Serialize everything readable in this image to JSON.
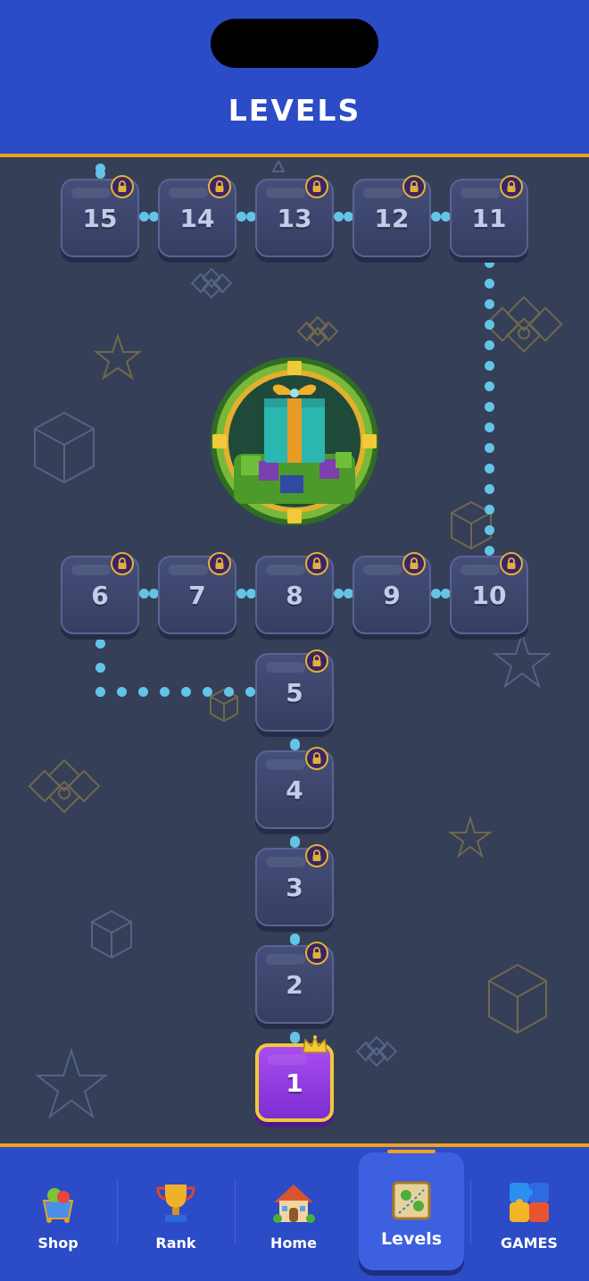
{
  "header": {
    "title": "LEVELS"
  },
  "levels": [
    {
      "number": "1",
      "state": "current"
    },
    {
      "number": "2",
      "state": "locked"
    },
    {
      "number": "3",
      "state": "locked"
    },
    {
      "number": "4",
      "state": "locked"
    },
    {
      "number": "5",
      "state": "locked"
    },
    {
      "number": "6",
      "state": "locked"
    },
    {
      "number": "7",
      "state": "locked"
    },
    {
      "number": "8",
      "state": "locked"
    },
    {
      "number": "9",
      "state": "locked"
    },
    {
      "number": "10",
      "state": "locked"
    },
    {
      "number": "11",
      "state": "locked"
    },
    {
      "number": "12",
      "state": "locked"
    },
    {
      "number": "13",
      "state": "locked"
    },
    {
      "number": "14",
      "state": "locked"
    },
    {
      "number": "15",
      "state": "locked"
    }
  ],
  "reward": {
    "icon": "gift-reward-icon"
  },
  "nav": {
    "items": [
      {
        "label": "Shop",
        "icon": "shop-basket-icon"
      },
      {
        "label": "Rank",
        "icon": "trophy-icon"
      },
      {
        "label": "Home",
        "icon": "house-icon"
      },
      {
        "label": "Levels",
        "icon": "map-icon",
        "active": true
      },
      {
        "label": "GAMES",
        "icon": "puzzle-icon"
      }
    ]
  },
  "colors": {
    "header": "#2b4bc7",
    "background": "#353f57",
    "accent": "#f0a21e",
    "path_dots": "#63c4e6",
    "active_level": "#a84df0"
  }
}
